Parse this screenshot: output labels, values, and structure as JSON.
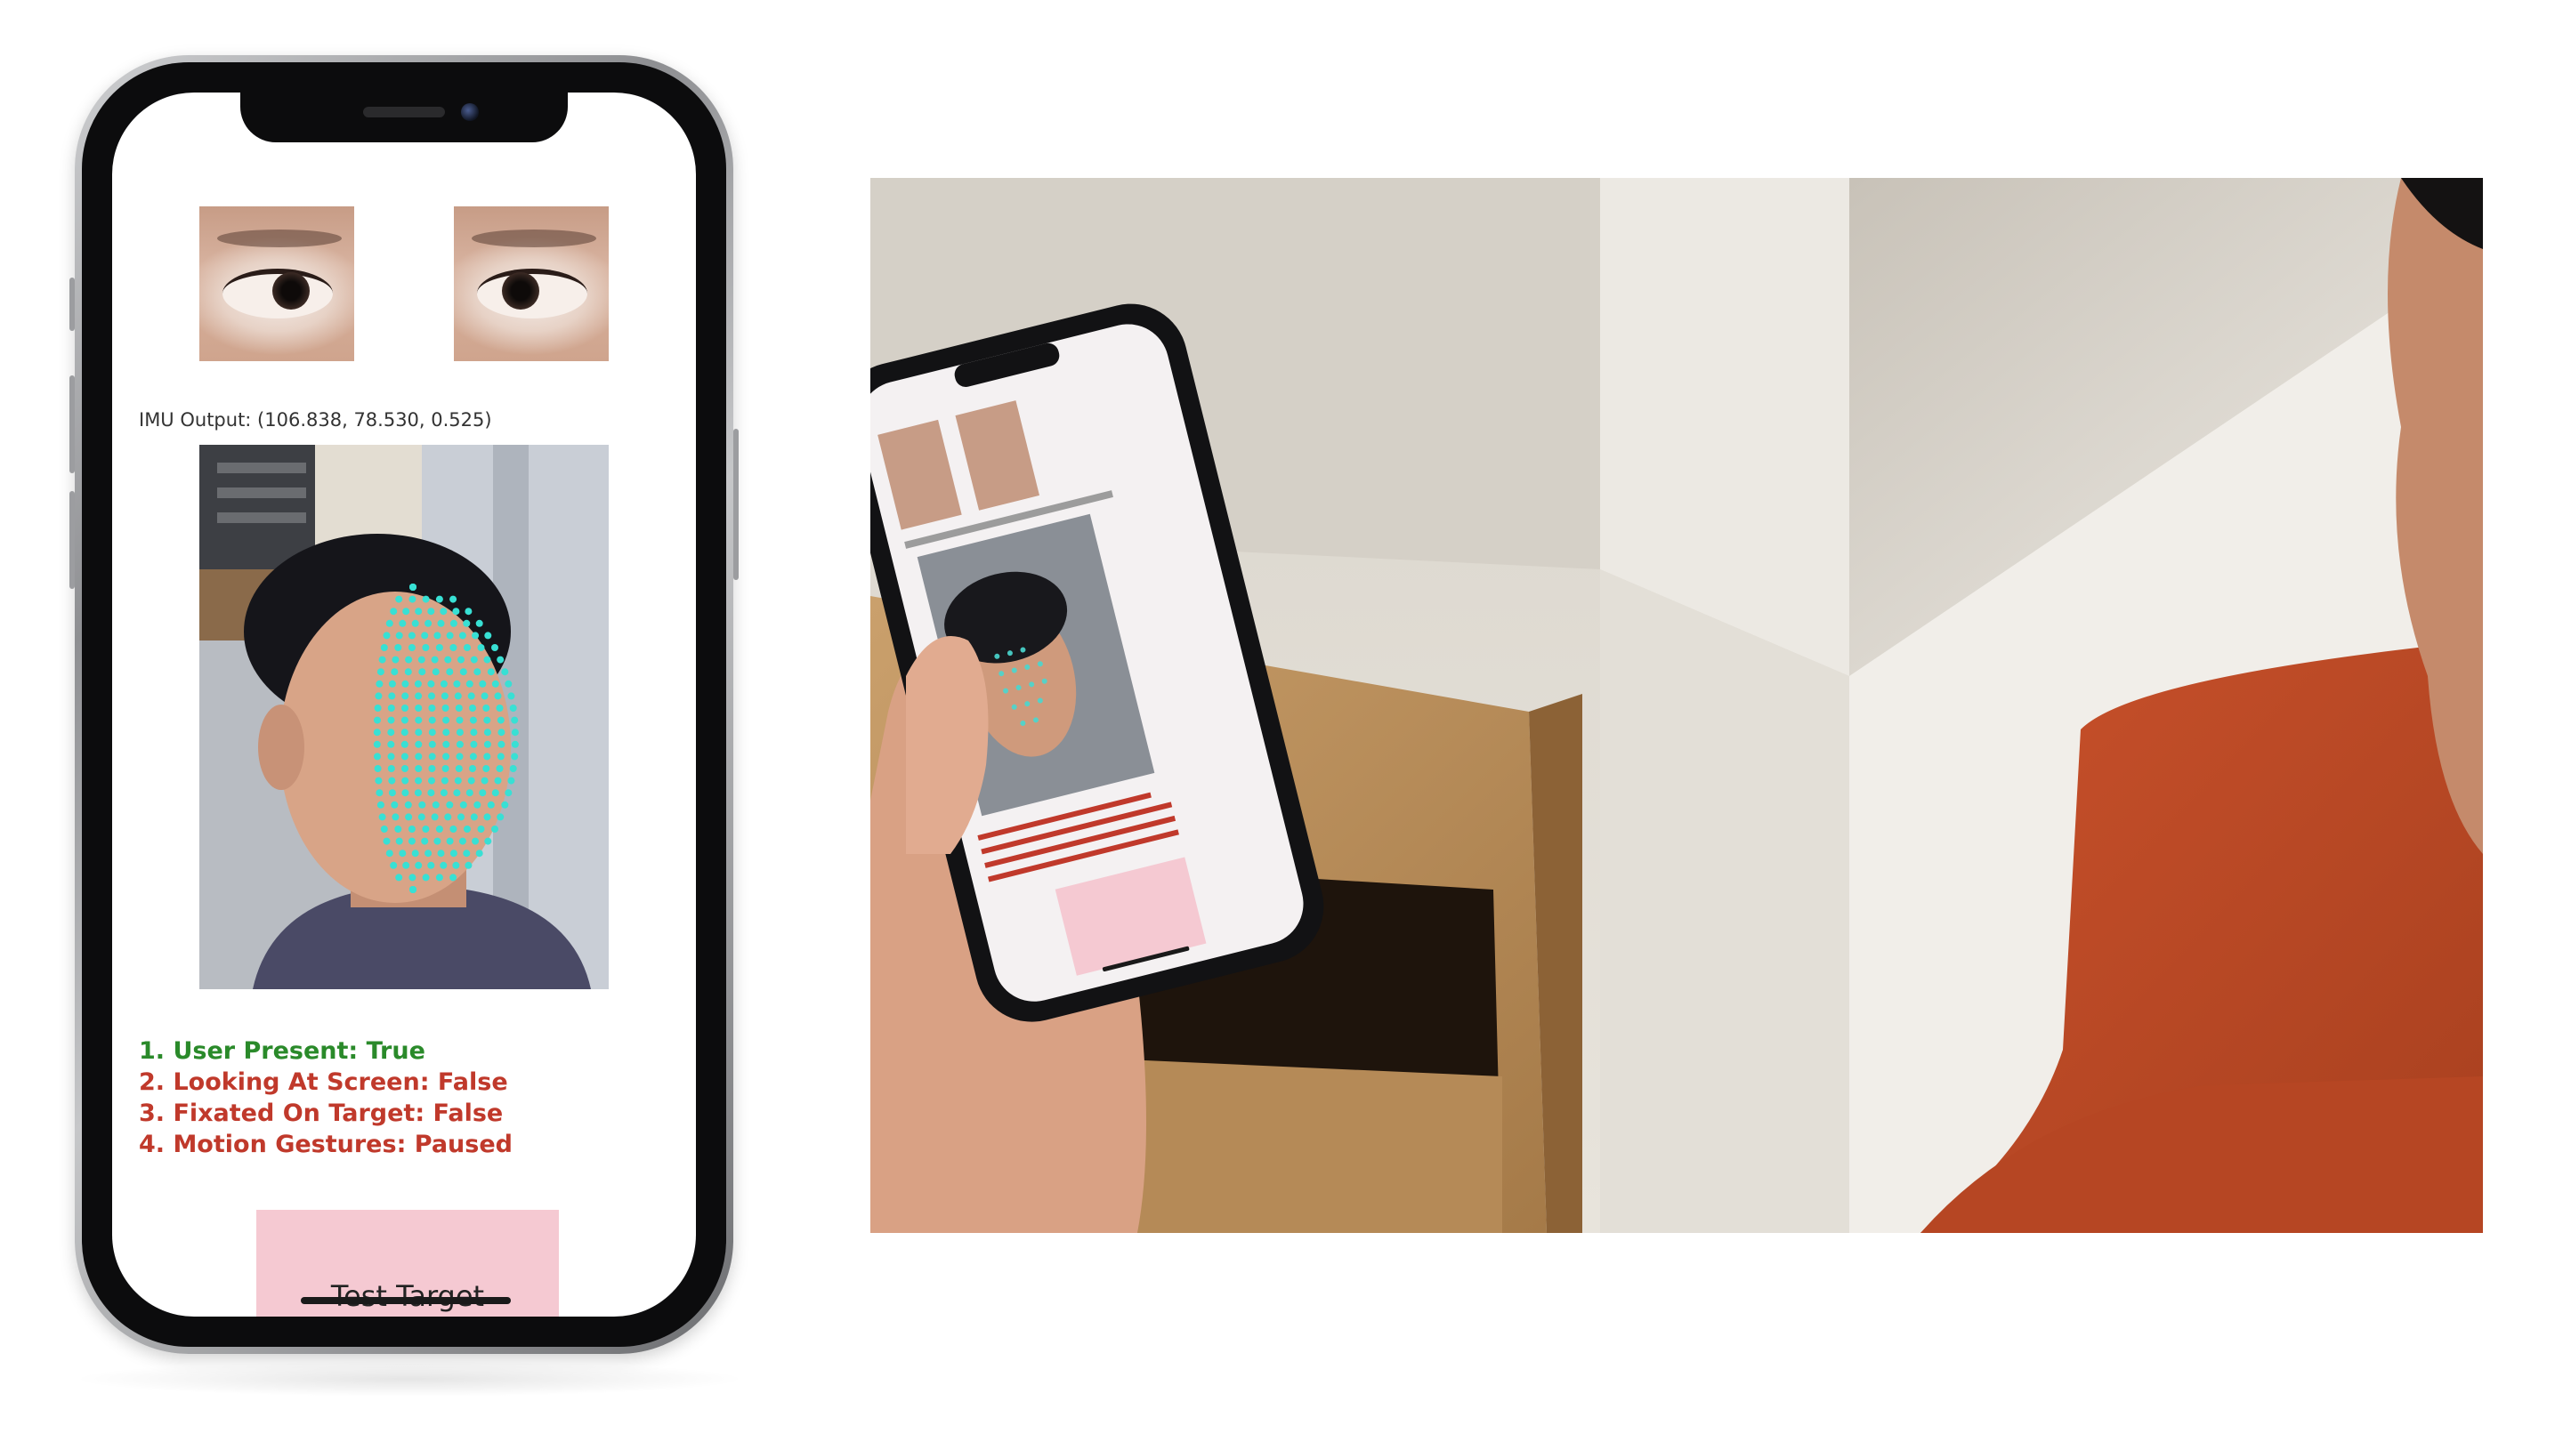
{
  "phone_ui": {
    "imu_output": "IMU Output: (106.838, 78.530, 0.525)",
    "status_items": [
      {
        "text": "1. User Present: True",
        "state": "ok"
      },
      {
        "text": "2. Looking At Screen: False",
        "state": "bad"
      },
      {
        "text": "3. Fixated On Target: False",
        "state": "bad"
      },
      {
        "text": "4. Motion Gestures: Paused",
        "state": "bad"
      }
    ],
    "test_target_label": "Test Target"
  },
  "colors": {
    "status_true": "#2a8a2a",
    "status_false": "#c0392b",
    "target_fill": "#f5c9d2",
    "mesh_dots": "#38e0d4"
  },
  "icons": {
    "front_camera": "camera-dot-icon",
    "speaker": "speaker-grille-icon"
  }
}
